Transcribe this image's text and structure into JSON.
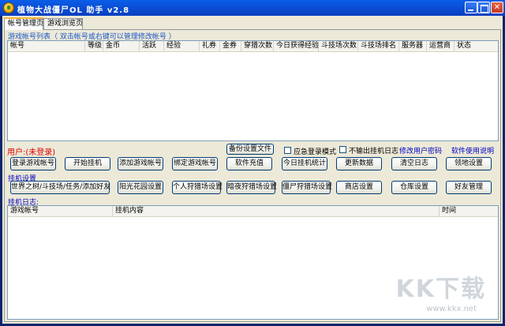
{
  "window": {
    "title": "植物大战僵尸OL 助手  v2.8"
  },
  "tabs": [
    {
      "label": "帐号管理页"
    },
    {
      "label": "游戏浏览页"
    }
  ],
  "accounts": {
    "section_label": "游戏帐号列表（ 双击帐号或右键可以管理修改帐号 ）",
    "columns": [
      "帐号",
      "等级",
      "金币",
      "活跃",
      "经验",
      "礼券",
      "金券",
      "穿猎次数",
      "今日获得经验",
      "斗技场次数",
      "斗技场排名",
      "服务器",
      "运营商",
      "状态"
    ]
  },
  "status": {
    "user_label": "用户:(未登录)",
    "backup_button": "备份设置文件",
    "emergency_login_label": "应急登录模式",
    "no_log_label": "不输出挂机日志",
    "change_password_link": "修改用户密码",
    "manual_link": "软件使用说明"
  },
  "toolbar_row1": [
    "登录游戏帐号",
    "开始挂机",
    "添加游戏帐号",
    "绑定游戏帐号",
    "软件充值",
    "今日挂机统计",
    "更新数据",
    "清空日志",
    "领地设置"
  ],
  "settings": {
    "section_label": "挂机设置",
    "buttons": [
      "世界之树/斗技场/任务/添加好友",
      "阳光花园设置",
      "个人狩猎场设置",
      "暗夜狩猎场设置",
      "僵尸狩猎场设置",
      "商店设置",
      "仓库设置",
      "好友管理"
    ]
  },
  "log": {
    "section_label": "挂机日志:",
    "columns": [
      "游戏帐号",
      "挂机内容",
      "时间"
    ]
  },
  "watermark": {
    "logo": "KK下载",
    "url": "www.kkx.net"
  }
}
